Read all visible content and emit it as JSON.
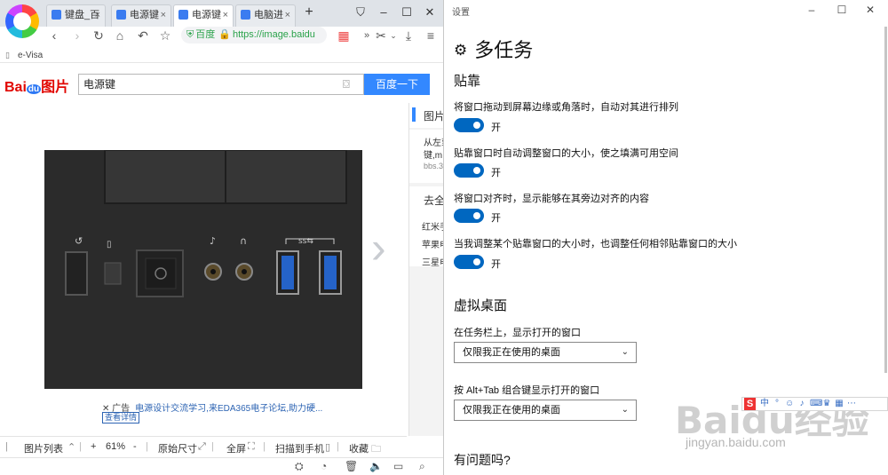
{
  "browser": {
    "tabs": [
      {
        "label": "键盘_百"
      },
      {
        "label": "电源键"
      },
      {
        "label": "电源键"
      },
      {
        "label": "电脑进"
      }
    ],
    "new_tab": "+",
    "address": {
      "site_label": "百度",
      "url": "https://image.baidu"
    },
    "bookmark": "e-Visa",
    "baidu_logo": {
      "part1": "Bai",
      "part2": "du",
      "part3": "图片"
    },
    "search_value": "电源键",
    "search_button": "百度一下",
    "ad": {
      "tag": "广告",
      "text": "电源设计交流学习,来EDA365电子论坛,助力硬...",
      "button": "查看详情"
    },
    "side_panel": {
      "tab": "图片",
      "result1_title": "从左到",
      "result1_sub": "键,m",
      "result1_site": "bbs.3",
      "section2": "去全",
      "items": [
        "红米手",
        "苹果电",
        "三星电"
      ]
    },
    "bottom_bar": {
      "list": "图片列表",
      "zoom_minus": "+",
      "zoom": "61%",
      "zoom_plus": "-",
      "original": "原始尺寸",
      "fullscreen": "全屏",
      "scan": "扫描到手机",
      "collect": "收藏"
    }
  },
  "settings": {
    "window_title": "设置",
    "page_title": "多任务",
    "snap": {
      "heading": "贴靠",
      "options": [
        {
          "label": "将窗口拖动到屏幕边缘或角落时，自动对其进行排列",
          "state": "开"
        },
        {
          "label": "贴靠窗口时自动调整窗口的大小，使之填满可用空间",
          "state": "开"
        },
        {
          "label": "将窗口对齐时，显示能够在其旁边对齐的内容",
          "state": "开"
        },
        {
          "label": "当我调整某个贴靠窗口的大小时，也调整任何相邻贴靠窗口的大小",
          "state": "开"
        }
      ]
    },
    "virtual_desktop": {
      "heading": "虚拟桌面",
      "taskbar_label": "在任务栏上，显示打开的窗口",
      "taskbar_value": "仅限我正在使用的桌面",
      "alttab_label": "按 Alt+Tab 组合键显示打开的窗口",
      "alttab_value": "仅限我正在使用的桌面"
    },
    "help_heading": "有问题吗?"
  },
  "watermark": {
    "main": "Baidu经验",
    "sub": "jingyan.baidu.com"
  },
  "colors": {
    "accent": "#0067c0",
    "baidu_blue": "#3388ff",
    "baidu_red": "#e10601"
  }
}
